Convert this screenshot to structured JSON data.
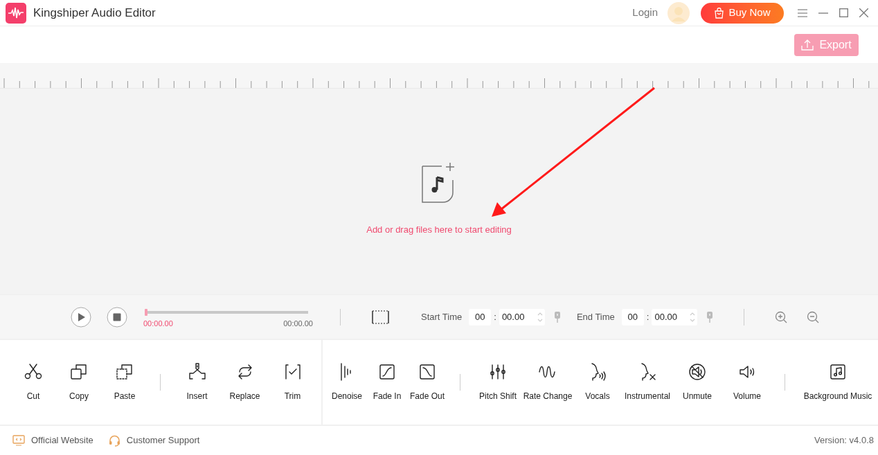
{
  "window": {
    "title": "Kingshiper Audio Editor"
  },
  "header": {
    "login": "Login",
    "buy_button": "Buy Now"
  },
  "export_button": {
    "label": "Export",
    "disabled": true
  },
  "drop_area": {
    "hint": "Add or drag files here to start editing"
  },
  "player": {
    "level": 0,
    "current_time": "00:00.00",
    "total_time": "00:00.00"
  },
  "range": [
    {
      "label": "Start Time",
      "minutes": "00",
      "separator": ":",
      "seconds": "00.00"
    },
    {
      "label": "End Time",
      "minutes": "00",
      "separator": ":",
      "seconds": "00.00"
    }
  ],
  "left_panel": [
    {
      "tools": [
        {
          "label": "Cut",
          "kind": "cut"
        },
        {
          "label": "Copy",
          "kind": "copy"
        },
        {
          "label": "Paste",
          "kind": "paste"
        }
      ]
    },
    {
      "tools": [
        {
          "label": "Insert",
          "kind": "insert"
        },
        {
          "label": "Replace",
          "kind": "replace"
        },
        {
          "label": "Trim",
          "kind": "trim"
        }
      ]
    }
  ],
  "right_panel": [
    {
      "tools": [
        {
          "label": "Denoise",
          "kind": "denoise"
        },
        {
          "label": "Fade In",
          "kind": "fadein"
        },
        {
          "label": "Fade Out",
          "kind": "fadeout"
        }
      ]
    },
    {
      "tools": [
        {
          "label": "Pitch Shift",
          "kind": "pitch"
        },
        {
          "label": "Rate Change",
          "kind": "rate"
        },
        {
          "label": "Vocals",
          "kind": "vocals"
        },
        {
          "label": "Instrumental",
          "kind": "instrumental"
        },
        {
          "label": "Unmute",
          "kind": "unmute"
        },
        {
          "label": "Volume",
          "kind": "volume"
        }
      ]
    },
    {
      "tools": [
        {
          "label": "Background Music",
          "kind": "music"
        }
      ]
    }
  ],
  "footer": {
    "links": [
      {
        "label": "Official Website",
        "kind": "website"
      },
      {
        "label": "Customer Support",
        "kind": "support"
      }
    ],
    "version": "Version: v4.0.8"
  }
}
